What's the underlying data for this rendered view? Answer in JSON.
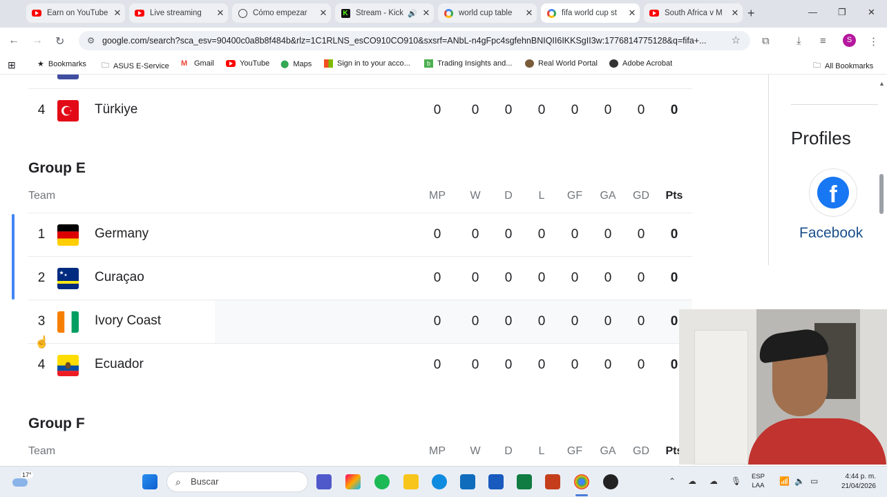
{
  "browser": {
    "tabs": [
      {
        "title": "Earn on YouTube",
        "icon": "youtube-icon"
      },
      {
        "title": "Live streaming",
        "icon": "youtube-icon"
      },
      {
        "title": "Cómo empezar",
        "icon": "openai-icon"
      },
      {
        "title": "Stream - Kick",
        "icon": "kick-icon",
        "audio": true
      },
      {
        "title": "world cup table",
        "icon": "google-icon"
      },
      {
        "title": "fifa world cup st",
        "icon": "google-icon",
        "active": true
      },
      {
        "title": "South Africa v M",
        "icon": "youtube-icon"
      }
    ],
    "url": "google.com/search?sca_esv=90400c0a8b8f484b&rlz=1C1RLNS_esCO910CO910&sxsrf=ANbL-n4gFpc4sgfehnBNIQII6IKKSgII3w:1776814775128&q=fifa+...",
    "profile_initial": "S",
    "bookmarks": [
      "Bookmarks",
      "ASUS E-Service",
      "Gmail",
      "YouTube",
      "Maps",
      "Sign in to your acco...",
      "Trading Insights and...",
      "Real World Portal",
      "Adobe Acrobat"
    ],
    "all_bookmarks": "All Bookmarks"
  },
  "standings": {
    "columns": [
      "Team",
      "MP",
      "W",
      "D",
      "L",
      "GF",
      "GA",
      "GD",
      "Pts"
    ],
    "prev_row": {
      "pos": "4",
      "team": "Türkiye",
      "stats": [
        "0",
        "0",
        "0",
        "0",
        "0",
        "0",
        "0",
        "0"
      ]
    },
    "group_e": {
      "title": "Group E",
      "rows": [
        {
          "pos": "1",
          "team": "Germany",
          "stats": [
            "0",
            "0",
            "0",
            "0",
            "0",
            "0",
            "0",
            "0"
          ]
        },
        {
          "pos": "2",
          "team": "Curaçao",
          "stats": [
            "0",
            "0",
            "0",
            "0",
            "0",
            "0",
            "0",
            "0"
          ]
        },
        {
          "pos": "3",
          "team": "Ivory Coast",
          "stats": [
            "0",
            "0",
            "0",
            "0",
            "0",
            "0",
            "0",
            "0"
          ]
        },
        {
          "pos": "4",
          "team": "Ecuador",
          "stats": [
            "0",
            "0",
            "0",
            "0",
            "0",
            "0",
            "0",
            "0"
          ]
        }
      ]
    },
    "group_f": {
      "title": "Group F"
    }
  },
  "sidebar": {
    "heading": "Profiles",
    "facebook": "Facebook"
  },
  "taskbar": {
    "weather": "17°",
    "search_placeholder": "Buscar",
    "lang": "ESP",
    "lang_sub": "LAA",
    "time": "4:44 p. m.",
    "date": "21/04/2026"
  }
}
